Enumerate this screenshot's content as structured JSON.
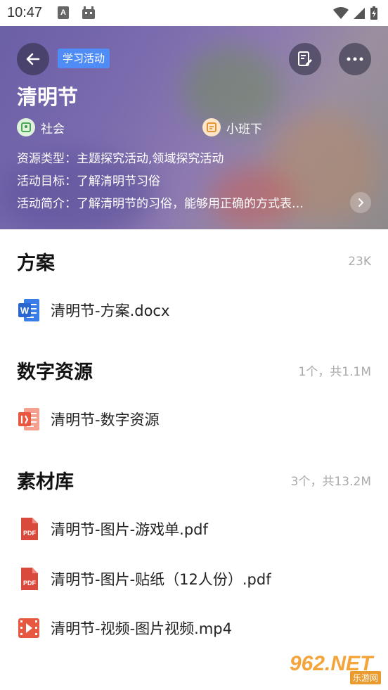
{
  "statusbar": {
    "time": "10:47",
    "a_badge": "A"
  },
  "hero": {
    "tag": "学习活动",
    "title": "清明节",
    "subject": "社会",
    "grade": "小班下",
    "resource_type": "资源类型：主题探究活动,领域探究活动",
    "goal": "活动目标：了解清明节习俗",
    "intro": "活动简介：了解清明节的习俗，能够用正确的方式表…"
  },
  "sections": [
    {
      "title": "方案",
      "meta": "23K",
      "files": [
        {
          "name": "清明节-方案.docx",
          "icon": "word-doc-icon"
        }
      ]
    },
    {
      "title": "数字资源",
      "meta": "1个，共1.1M",
      "files": [
        {
          "name": "清明节-数字资源",
          "icon": "presentation-icon"
        }
      ]
    },
    {
      "title": "素材库",
      "meta": "3个，共13.2M",
      "files": [
        {
          "name": "清明节-图片-游戏单.pdf",
          "icon": "pdf-icon"
        },
        {
          "name": "清明节-图片-贴纸（12人份）.pdf",
          "icon": "pdf-icon"
        },
        {
          "name": "清明节-视频-图片视频.mp4",
          "icon": "video-icon"
        }
      ]
    }
  ],
  "watermark": {
    "big": "962.NET",
    "sub": "乐游网"
  },
  "colors": {
    "tag": "#4f8cf5",
    "pdf": "#d94a3d",
    "word": "#3b7de8",
    "ppt": "#e8573f"
  }
}
